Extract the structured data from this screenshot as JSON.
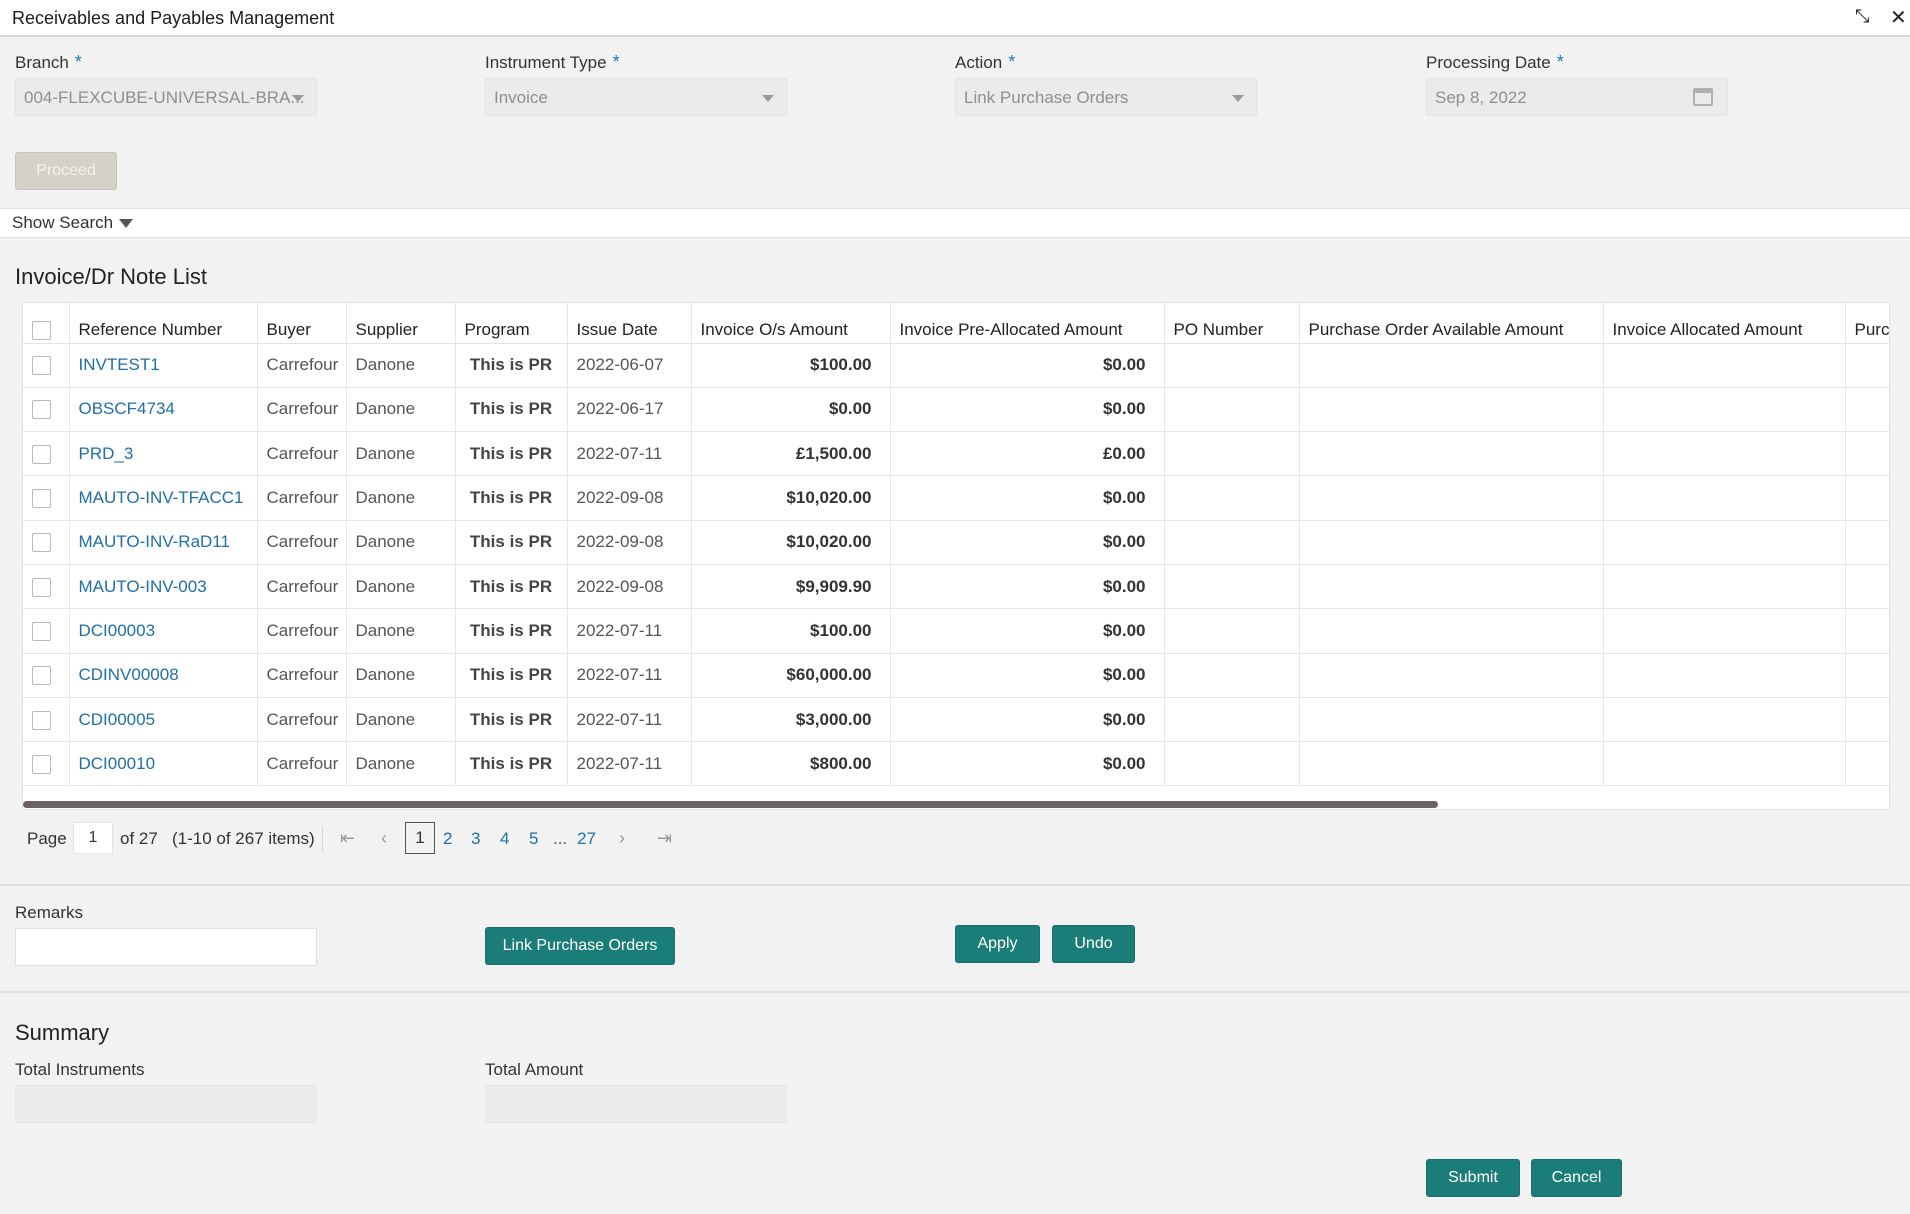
{
  "window": {
    "title": "Receivables and Payables Management",
    "minimize_glyph": "⤡",
    "close_glyph": "✕"
  },
  "form": {
    "branch_label": "Branch",
    "branch_value": "004-FLEXCUBE-UNIVERSAL-BRA...",
    "instrument_type_label": "Instrument Type",
    "instrument_type_value": "Invoice",
    "action_label": "Action",
    "action_value": "Link Purchase Orders",
    "processing_date_label": "Processing Date",
    "processing_date_value": "Sep 8, 2022",
    "required_mark": "*",
    "proceed_label": "Proceed"
  },
  "search": {
    "toggle_label": "Show Search"
  },
  "list": {
    "title": "Invoice/Dr Note List",
    "columns": [
      "Reference Number",
      "Buyer",
      "Supplier",
      "Program",
      "Issue Date",
      "Invoice O/s Amount",
      "Invoice Pre-Allocated Amount",
      "PO Number",
      "Purchase Order Available Amount",
      "Invoice Allocated Amount",
      "Purcl"
    ],
    "rows": [
      {
        "ref": "INVTEST1",
        "buyer": "Carrefour",
        "supplier": "Danone",
        "program": "This is PR",
        "issue_date": "2022-06-07",
        "os_amount": "$100.00",
        "pre_alloc": "$0.00"
      },
      {
        "ref": "OBSCF4734",
        "buyer": "Carrefour",
        "supplier": "Danone",
        "program": "This is PR",
        "issue_date": "2022-06-17",
        "os_amount": "$0.00",
        "pre_alloc": "$0.00"
      },
      {
        "ref": "PRD_3",
        "buyer": "Carrefour",
        "supplier": "Danone",
        "program": "This is PR",
        "issue_date": "2022-07-11",
        "os_amount": "£1,500.00",
        "pre_alloc": "£0.00"
      },
      {
        "ref": "MAUTO-INV-TFACC1",
        "buyer": "Carrefour",
        "supplier": "Danone",
        "program": "This is PR",
        "issue_date": "2022-09-08",
        "os_amount": "$10,020.00",
        "pre_alloc": "$0.00"
      },
      {
        "ref": "MAUTO-INV-RaD11",
        "buyer": "Carrefour",
        "supplier": "Danone",
        "program": "This is PR",
        "issue_date": "2022-09-08",
        "os_amount": "$10,020.00",
        "pre_alloc": "$0.00"
      },
      {
        "ref": "MAUTO-INV-003",
        "buyer": "Carrefour",
        "supplier": "Danone",
        "program": "This is PR",
        "issue_date": "2022-09-08",
        "os_amount": "$9,909.90",
        "pre_alloc": "$0.00"
      },
      {
        "ref": "DCI00003",
        "buyer": "Carrefour",
        "supplier": "Danone",
        "program": "This is PR",
        "issue_date": "2022-07-11",
        "os_amount": "$100.00",
        "pre_alloc": "$0.00"
      },
      {
        "ref": "CDINV00008",
        "buyer": "Carrefour",
        "supplier": "Danone",
        "program": "This is PR",
        "issue_date": "2022-07-11",
        "os_amount": "$60,000.00",
        "pre_alloc": "$0.00"
      },
      {
        "ref": "CDI00005",
        "buyer": "Carrefour",
        "supplier": "Danone",
        "program": "This is PR",
        "issue_date": "2022-07-11",
        "os_amount": "$3,000.00",
        "pre_alloc": "$0.00"
      },
      {
        "ref": "DCI00010",
        "buyer": "Carrefour",
        "supplier": "Danone",
        "program": "This is PR",
        "issue_date": "2022-07-11",
        "os_amount": "$800.00",
        "pre_alloc": "$0.00"
      }
    ]
  },
  "pagination": {
    "page_label": "Page",
    "current_page": "1",
    "of_label": "of 27",
    "items_label": "(1-10 of 267 items)",
    "pages": [
      "1",
      "2",
      "3",
      "4",
      "5",
      "...",
      "27"
    ],
    "first_glyph": "⇤",
    "prev_glyph": "‹",
    "next_glyph": "›",
    "last_glyph": "⇥"
  },
  "remarks": {
    "label": "Remarks",
    "value": "",
    "link_po_label": "Link Purchase Orders",
    "apply_label": "Apply",
    "undo_label": "Undo"
  },
  "summary": {
    "title": "Summary",
    "total_instruments_label": "Total Instruments",
    "total_amount_label": "Total Amount"
  },
  "footer": {
    "submit_label": "Submit",
    "cancel_label": "Cancel"
  },
  "colors": {
    "accent": "#1b7d78",
    "link": "#1f6fa8",
    "required": "#1f7ab8"
  }
}
